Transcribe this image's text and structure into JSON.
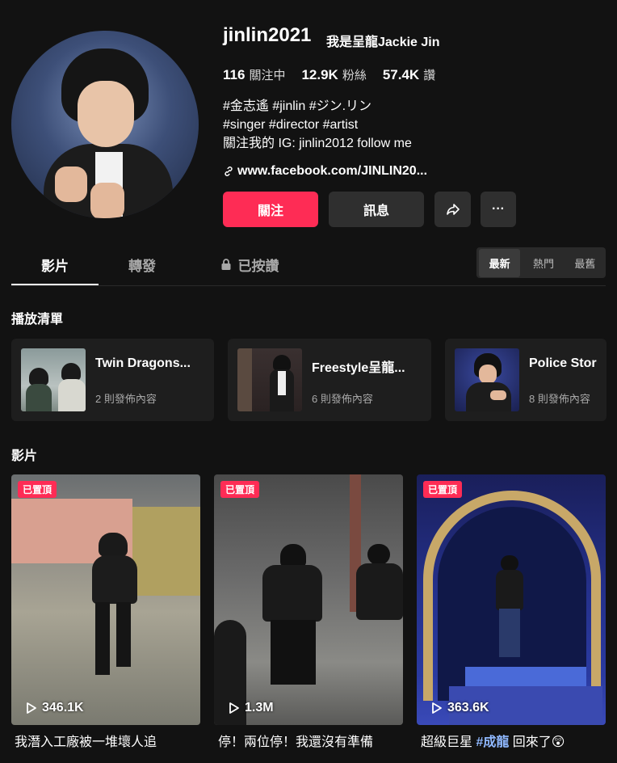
{
  "profile": {
    "username": "jinlin2021",
    "nickname": "我是呈龍Jackie Jin",
    "stats": [
      {
        "value": "116",
        "label": "關注中"
      },
      {
        "value": "12.9K",
        "label": "粉絲"
      },
      {
        "value": "57.4K",
        "label": "讚"
      }
    ],
    "bio": [
      "#金志遙 #jinlin #ジン.リン",
      "#singer #director #artist",
      "關注我的 IG: jinlin2012 follow me"
    ],
    "link": "www.facebook.com/JINLIN20..."
  },
  "actions": {
    "follow": "關注",
    "message": "訊息",
    "share_icon": "share-icon",
    "more": "···"
  },
  "tabs": [
    {
      "label": "影片",
      "active": true
    },
    {
      "label": "轉發",
      "active": false
    },
    {
      "label": "已按讚",
      "active": false,
      "icon": "lock-icon"
    }
  ],
  "sort": [
    "最新",
    "熱門",
    "最舊"
  ],
  "playlists_title": "播放清單",
  "playlists": [
    {
      "title": "Twin Dragons...",
      "count": "2 則發佈內容"
    },
    {
      "title": "Freestyle呈龍...",
      "count": "6 則發佈內容"
    },
    {
      "title": "Police Stor",
      "count": "8 則發佈內容"
    }
  ],
  "videos_title": "影片",
  "videos": [
    {
      "pinned": "已置頂",
      "views": "346.1K",
      "caption": "我潛入工廠被一堆壞人追"
    },
    {
      "pinned": "已置頂",
      "views": "1.3M",
      "caption": "停！兩位停！我還沒有準備"
    },
    {
      "pinned": "已置頂",
      "views": "363.6K",
      "caption_pre": "超級巨星 ",
      "caption_tag": "#成龍",
      "caption_post": " 回來了😲"
    }
  ],
  "colors": {
    "accent": "#fe2c55",
    "background": "#121212",
    "hashtag": "#8fb8ff"
  }
}
